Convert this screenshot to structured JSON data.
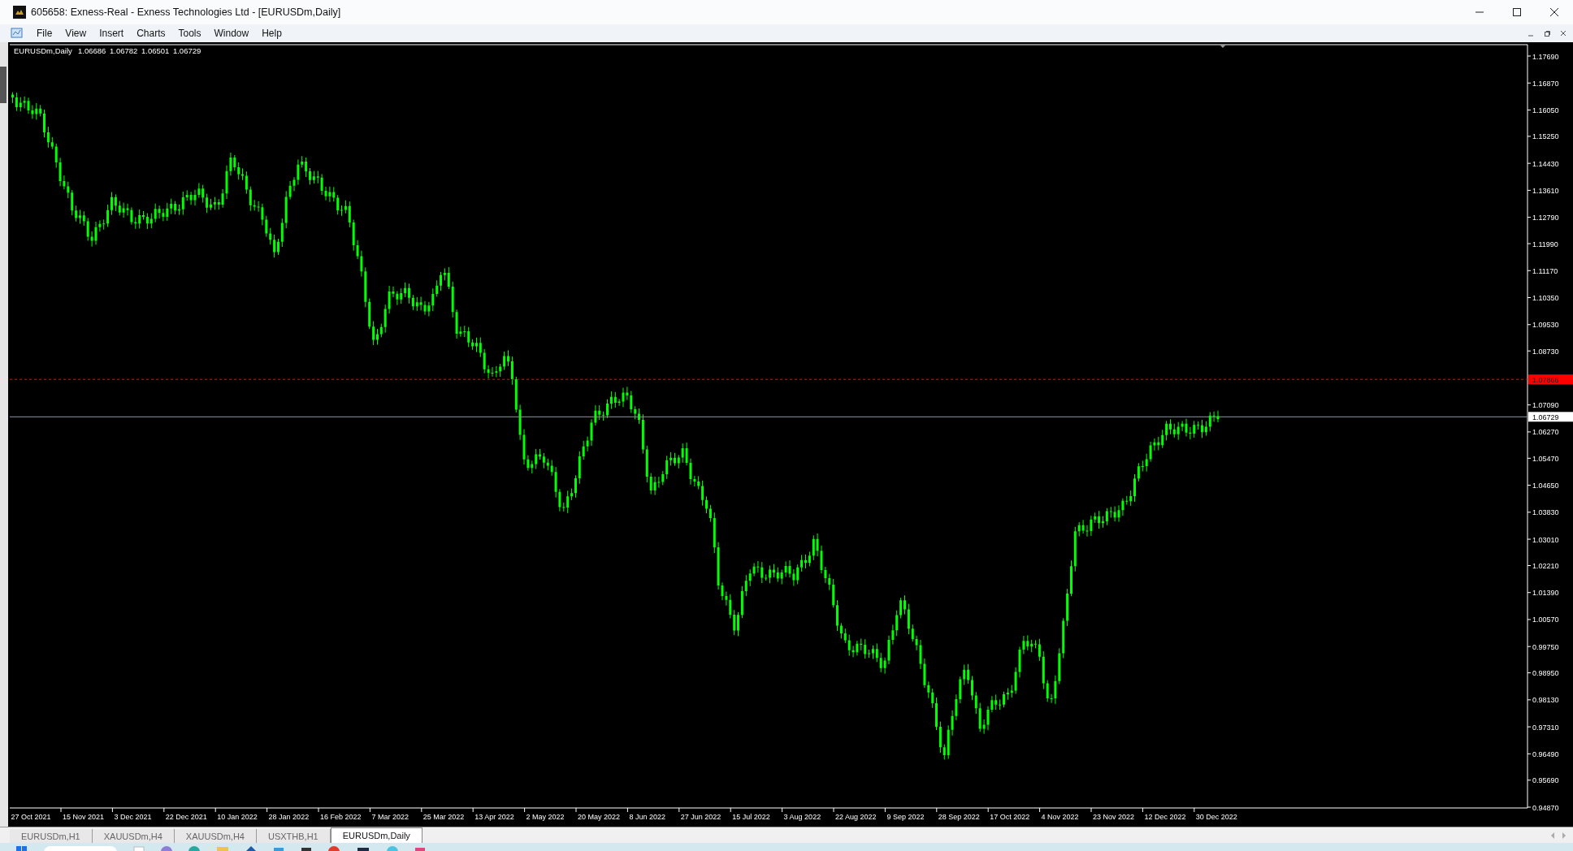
{
  "window": {
    "title": "605658: Exness-Real - Exness Technologies Ltd - [EURUSDm,Daily]"
  },
  "menu": [
    "File",
    "View",
    "Insert",
    "Charts",
    "Tools",
    "Window",
    "Help"
  ],
  "chart": {
    "symbol": "EURUSDm,Daily",
    "ohlc": [
      "1.06686",
      "1.06782",
      "1.06501",
      "1.06729"
    ],
    "price_labels": [
      "1.17690",
      "1.16870",
      "1.16050",
      "1.15250",
      "1.14430",
      "1.13610",
      "1.12790",
      "1.11990",
      "1.11170",
      "1.10350",
      "1.09530",
      "1.08730",
      "1.07090",
      "1.06270",
      "1.05470",
      "1.04650",
      "1.03830",
      "1.03010",
      "1.02210",
      "1.01390",
      "1.00570",
      "0.99750",
      "0.98950",
      "0.98130",
      "0.97310",
      "0.96490",
      "0.95690",
      "0.94870"
    ],
    "ask_line": {
      "price": "1.07866"
    },
    "bid_line": {
      "price": "1.06729"
    },
    "date_labels": [
      "27 Oct 2021",
      "15 Nov 2021",
      "3 Dec 2021",
      "22 Dec 2021",
      "10 Jan 2022",
      "28 Jan 2022",
      "16 Feb 2022",
      "7 Mar 2022",
      "25 Mar 2022",
      "13 Apr 2022",
      "2 May 2022",
      "20 May 2022",
      "8 Jun 2022",
      "27 Jun 2022",
      "15 Jul 2022",
      "3 Aug 2022",
      "22 Aug 2022",
      "9 Sep 2022",
      "28 Sep 2022",
      "17 Oct 2022",
      "4 Nov 2022",
      "23 Nov 2022",
      "12 Dec 2022",
      "30 Dec 2022"
    ]
  },
  "tabs": [
    {
      "label": "EURUSDm,H1",
      "selected": false
    },
    {
      "label": "XAUUSDm,H4",
      "selected": false
    },
    {
      "label": "XAUUSDm,H4",
      "selected": false
    },
    {
      "label": "USXTHB,H1",
      "selected": false
    },
    {
      "label": "EURUSDm,Daily",
      "selected": true
    }
  ]
}
